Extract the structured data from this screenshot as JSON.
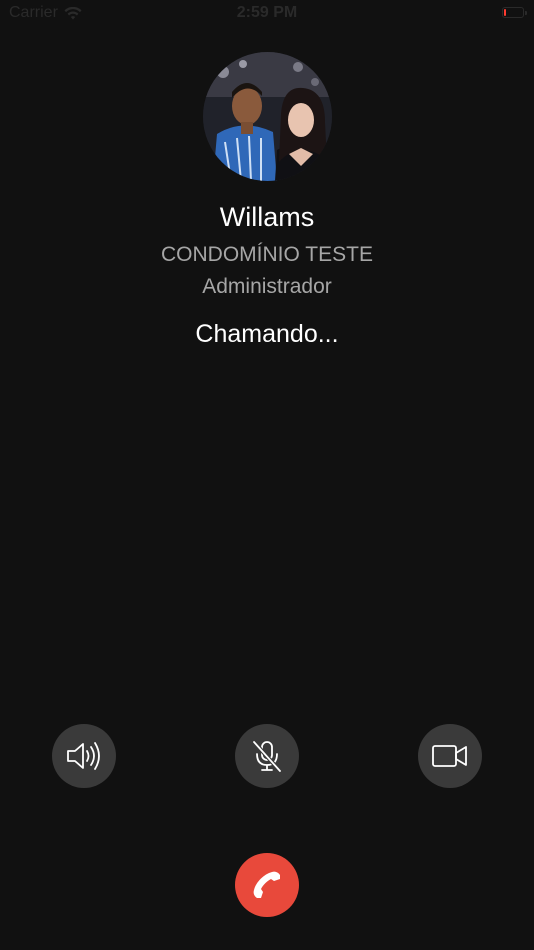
{
  "status_bar": {
    "carrier": "Carrier",
    "time": "2:59 PM",
    "battery_level_fraction": 0.1
  },
  "caller": {
    "name": "Willams",
    "organization": "CONDOMÍNIO TESTE",
    "role": "Administrador",
    "avatar_icon": "caller-photo"
  },
  "call": {
    "status": "Chamando..."
  },
  "controls": {
    "speaker_icon": "speaker-icon",
    "mute_icon": "microphone-muted-icon",
    "video_icon": "video-camera-icon",
    "end_call_icon": "phone-hangup-icon"
  },
  "colors": {
    "background": "#111111",
    "control_bg": "#3a3a3a",
    "end_call": "#e8493b",
    "secondary_text": "#a6a6a6",
    "battery_low": "#ff3b30"
  }
}
